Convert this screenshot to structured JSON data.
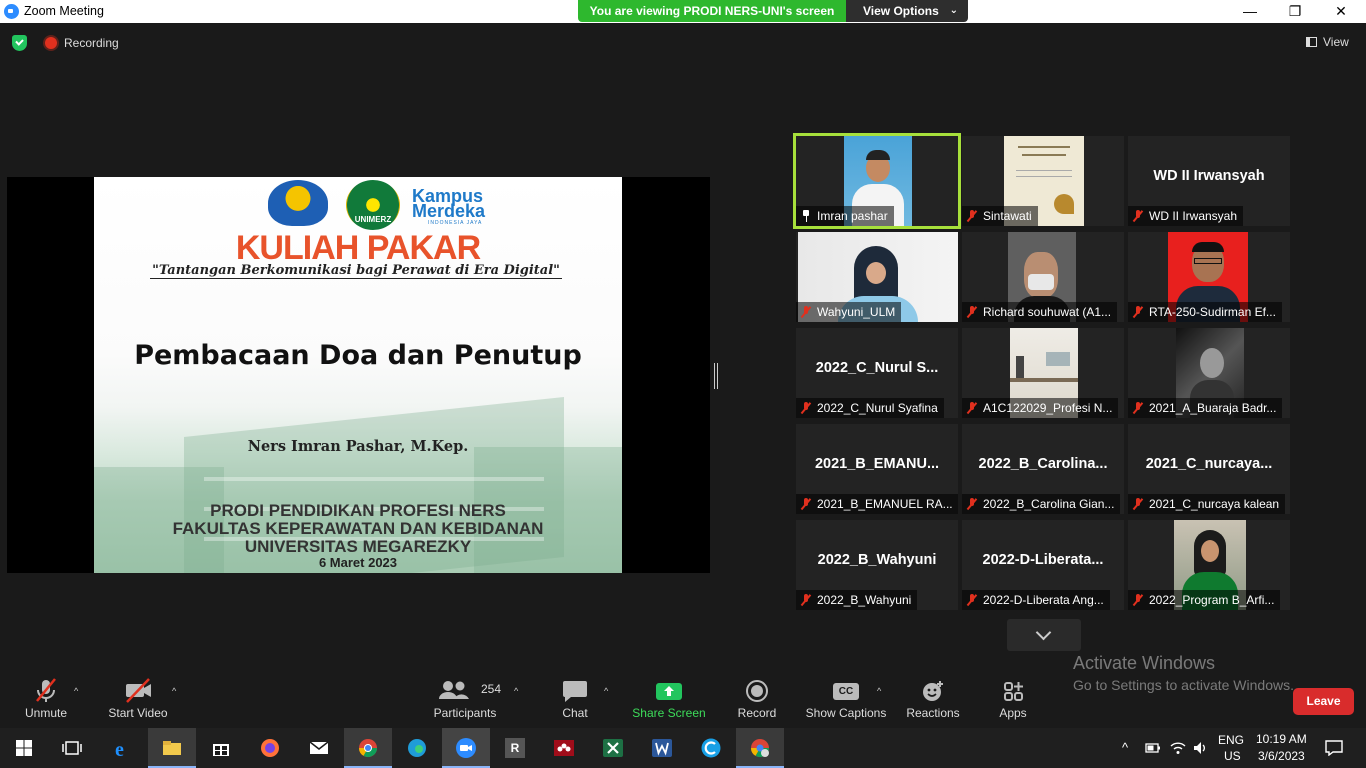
{
  "window": {
    "title": "Zoom Meeting",
    "minimize": "—",
    "maximize": "❐",
    "close": "✕"
  },
  "banner": {
    "text": "You are viewing PRODI NERS-UNI's screen",
    "options_label": "View Options",
    "chevron": "⌄"
  },
  "topbar": {
    "recording_label": "Recording",
    "view_label": "View"
  },
  "slide": {
    "logo_text_unimerz": "UNIMERZ",
    "logo_text_kampus": "Kampus",
    "logo_text_merdeka": "Merdeka",
    "logo_text_sub": "INDONESIA JAYA",
    "title": "KULIAH PAKAR",
    "subtitle": "\"Tantangan Berkomunikasi bagi Perawat di Era Digital\"",
    "heading": "Pembacaan Doa dan Penutup",
    "speaker": "Ners Imran Pashar, M.Kep.",
    "institution_1": "PRODI PENDIDIKAN PROFESI NERS",
    "institution_2": "FAKULTAS KEPERAWATAN DAN KEBIDANAN",
    "institution_3": "UNIVERSITAS MEGAREZKY",
    "date": "6 Maret 2023"
  },
  "participants": [
    {
      "label": "Imran pashar",
      "big": "",
      "active": true,
      "mic": "pin",
      "video": "man-white-shirt"
    },
    {
      "label": "Sintawati",
      "big": "",
      "active": false,
      "mic": "muted",
      "video": "card"
    },
    {
      "label": "WD II Irwansyah",
      "big": "WD II Irwansyah",
      "active": false,
      "mic": "muted",
      "video": ""
    },
    {
      "label": "Wahyuni_ULM",
      "big": "",
      "active": false,
      "mic": "muted",
      "video": "woman-hijab"
    },
    {
      "label": "Richard souhuwat (A1...",
      "big": "",
      "active": false,
      "mic": "muted",
      "video": "man-mask"
    },
    {
      "label": "RTA-250-Sudirman Ef...",
      "big": "",
      "active": false,
      "mic": "muted",
      "video": "man-red-bg"
    },
    {
      "label": "2022_C_Nurul Syafina",
      "big": "2022_C_Nurul S...",
      "active": false,
      "mic": "muted",
      "video": ""
    },
    {
      "label": "A1C122029_Profesi N...",
      "big": "",
      "active": false,
      "mic": "muted",
      "video": "room"
    },
    {
      "label": "2021_A_Buaraja Badr...",
      "big": "",
      "active": false,
      "mic": "muted",
      "video": "bw-photo"
    },
    {
      "label": "2021_B_EMANUEL RA...",
      "big": "2021_B_EMANU...",
      "active": false,
      "mic": "muted",
      "video": ""
    },
    {
      "label": "2022_B_Carolina Gian...",
      "big": "2022_B_Carolina...",
      "active": false,
      "mic": "muted",
      "video": ""
    },
    {
      "label": "2021_C_nurcaya kalean",
      "big": "2021_C_nurcaya...",
      "active": false,
      "mic": "muted",
      "video": ""
    },
    {
      "label": "2022_B_Wahyuni",
      "big": "2022_B_Wahyuni",
      "active": false,
      "mic": "muted",
      "video": ""
    },
    {
      "label": "2022-D-Liberata Ang...",
      "big": "2022-D-Liberata...",
      "active": false,
      "mic": "muted",
      "video": ""
    },
    {
      "label": "2022_Program B_Arfi...",
      "big": "",
      "active": false,
      "mic": "muted",
      "video": "woman-green"
    }
  ],
  "watermark": {
    "line1": "Activate Windows",
    "line2": "Go to Settings to activate Windows."
  },
  "toolbar": {
    "unmute": "Unmute",
    "start_video": "Start Video",
    "participants": "Participants",
    "participants_count": "254",
    "chat": "Chat",
    "share_screen": "Share Screen",
    "record": "Record",
    "show_captions": "Show Captions",
    "captions_icon": "CC",
    "reactions": "Reactions",
    "apps": "Apps",
    "leave": "Leave",
    "caret": "^"
  },
  "taskbar": {
    "lang_1": "ENG",
    "lang_2": "US",
    "time": "10:19 AM",
    "date": "3/6/2023",
    "r_app": "R"
  },
  "colors": {
    "accent_green": "#2eb82e",
    "leave_red": "#d92c2c",
    "active_border": "#a7e03b",
    "share_green": "#22c55e"
  }
}
